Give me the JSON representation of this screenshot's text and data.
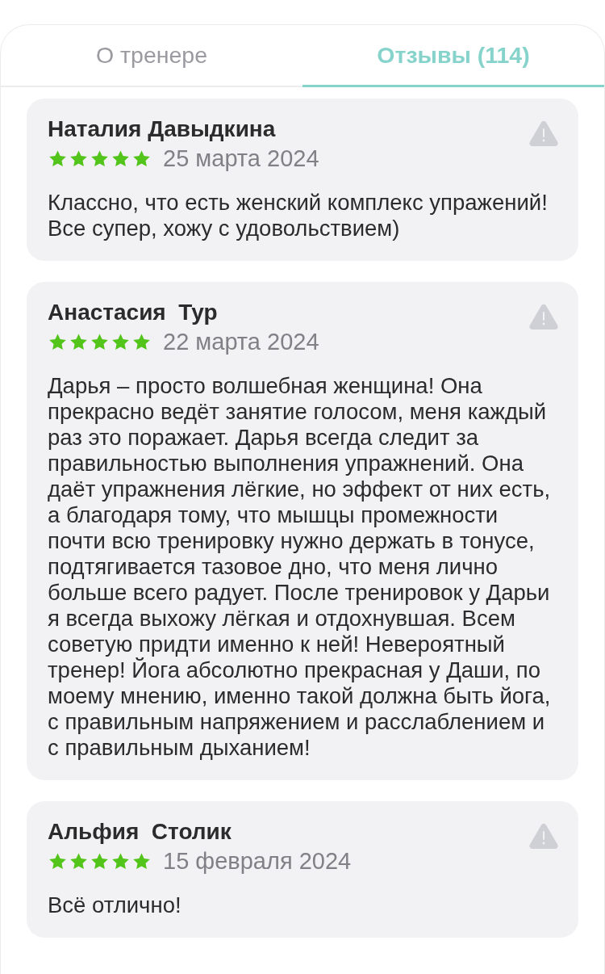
{
  "tabs": [
    {
      "label": "О тренере",
      "selected": false
    },
    {
      "label": "Отзывы (114)",
      "selected": true
    }
  ],
  "reviews": [
    {
      "author": "Наталия Давыдкина",
      "stars": 5,
      "date": "25 марта 2024",
      "text": "Классно, что есть женский комплекс упражений! Все супер, хожу с удовольствием)"
    },
    {
      "author": "Анастасия  Тур",
      "stars": 5,
      "date": "22 марта 2024",
      "text": "Дарья – просто волшебная женщина! Она прекрасно ведёт занятие голосом, меня каждый раз это поражает. Дарья всегда следит за правильностью выполнения упражнений. Она даёт упражнения лёгкие, но эффект от них есть, а благодаря тому, что мышцы промежности почти всю тренировку нужно держать в тонусе,  подтягивается тазовое дно, что меня лично больше всего радует. После тренировок у Дарьи я всегда выхожу лёгкая и отдохнувшая. Всем советую придти именно к ней! Невероятный тренер! Йога абсолютно прекрасная у Даши, по моему мнению, именно такой должна быть йога, с правильным напряжением и расслаблением и с правильным дыханием!"
    },
    {
      "author": "Альфия  Столик",
      "stars": 5,
      "date": "15 февраля 2024",
      "text": "Всё отлично!"
    }
  ]
}
